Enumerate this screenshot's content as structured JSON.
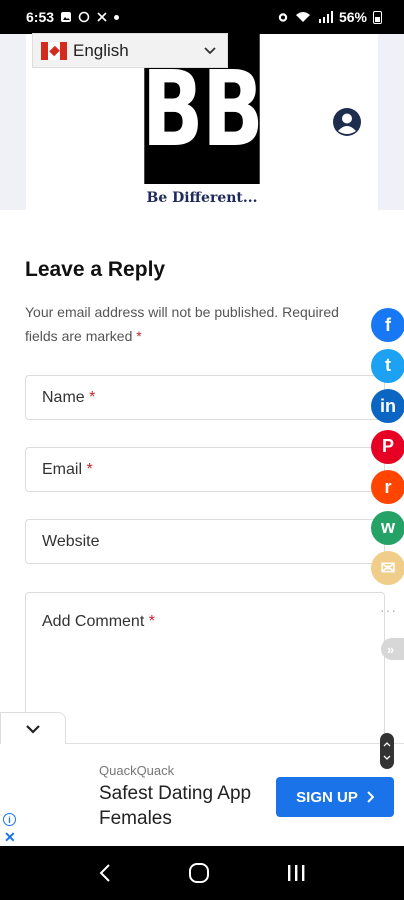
{
  "status_bar": {
    "time": "6:53",
    "battery": "56%"
  },
  "header": {
    "language": "English",
    "logo_text": "BB",
    "tagline": "Be Different..."
  },
  "reply": {
    "title": "Leave a Reply",
    "note": "Your email address will not be published. Required fields are marked",
    "required_mark": "*"
  },
  "form": {
    "name_placeholder": "Name",
    "email_placeholder": "Email",
    "website_placeholder": "Website",
    "comment_placeholder": "Add Comment"
  },
  "share": {
    "items": [
      {
        "name": "facebook",
        "color": "#1877f2",
        "glyph": "f"
      },
      {
        "name": "twitter",
        "color": "#1da1f2",
        "glyph": "t"
      },
      {
        "name": "linkedin",
        "color": "#0a66c2",
        "glyph": "in"
      },
      {
        "name": "pinterest",
        "color": "#e60023",
        "glyph": "P"
      },
      {
        "name": "reddit",
        "color": "#ff4500",
        "glyph": "r"
      },
      {
        "name": "whatsapp",
        "color": "#25a366",
        "glyph": "w"
      },
      {
        "name": "email",
        "color": "#f0cd88",
        "glyph": "✉"
      }
    ],
    "more": "···",
    "expand": "»"
  },
  "ad": {
    "advertiser": "QuackQuack",
    "headline": "Safest Dating App Females",
    "cta": "SIGN UP"
  },
  "colors": {
    "accent": "#1a73e8",
    "required": "#c0272d",
    "logo_bg": "#000000",
    "tagline": "#1e2a5a"
  }
}
